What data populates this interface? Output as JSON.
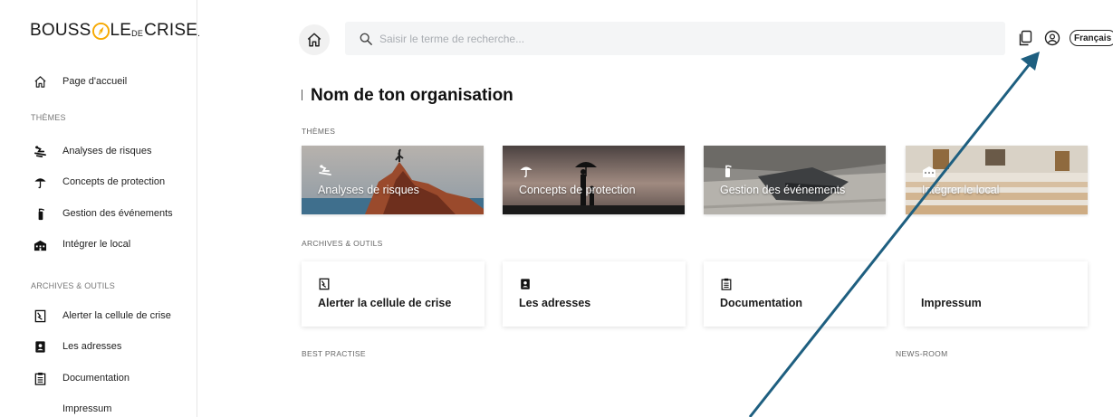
{
  "colors": {
    "accent": "#f6a800",
    "arrow": "#1e5f80",
    "search_bg": "#f4f5f6"
  },
  "logo": {
    "part1": "BOUSS",
    "part2": "LE",
    "part3": "DE",
    "part4": "CRISE",
    "part5": ".",
    "icon": "compass-logo-icon"
  },
  "sidebar": {
    "home": {
      "label": "Page d'accueil",
      "icon": "home-icon"
    },
    "themes_title": "THÈMES",
    "themes": [
      {
        "label": "Analyses de risques",
        "icon": "climber-icon"
      },
      {
        "label": "Concepts de protection",
        "icon": "umbrella-icon"
      },
      {
        "label": "Gestion des événements",
        "icon": "fire-extinguisher-icon"
      },
      {
        "label": "Intégrer le local",
        "icon": "building-icon"
      }
    ],
    "tools_title": "ARCHIVES & OUTILS",
    "tools": [
      {
        "label": "Alerter la cellule de crise",
        "icon": "alert-document-icon"
      },
      {
        "label": "Les adresses",
        "icon": "address-book-icon"
      },
      {
        "label": "Documentation",
        "icon": "clipboard-icon"
      },
      {
        "label": "Impressum",
        "icon": ""
      }
    ]
  },
  "header": {
    "search_placeholder": "Saisir le terme de recherche...",
    "language": "Français"
  },
  "main": {
    "title": "Nom de ton organisation",
    "themes_title": "THÈMES",
    "theme_cards": [
      {
        "label": "Analyses de risques"
      },
      {
        "label": "Concepts de protection"
      },
      {
        "label": "Gestion des événements"
      },
      {
        "label": "Intégrer le local"
      }
    ],
    "tools_title": "ARCHIVES & OUTILS",
    "tool_cards": [
      {
        "label": "Alerter la cellule de crise"
      },
      {
        "label": "Les adresses"
      },
      {
        "label": "Documentation"
      },
      {
        "label": "Impressum"
      }
    ],
    "best_practise_title": "BEST PRACTISE",
    "newsroom_title": "NEWS-ROOM"
  }
}
